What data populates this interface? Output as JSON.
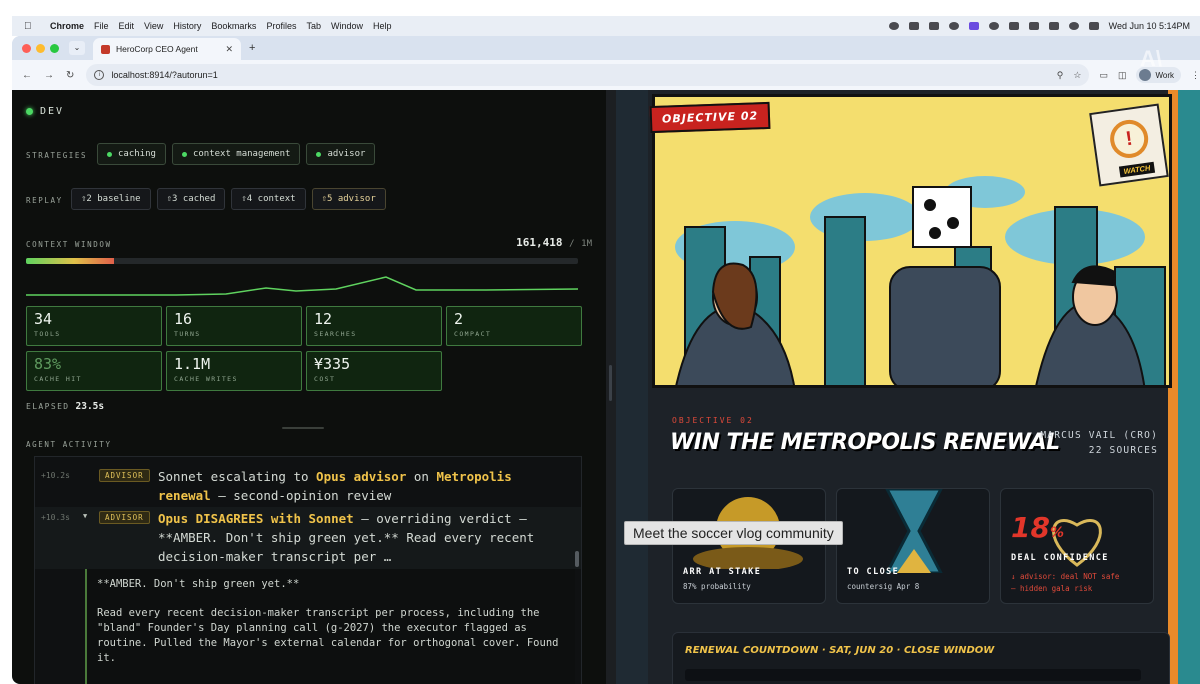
{
  "menubar": {
    "app": "Chrome",
    "items": [
      "File",
      "Edit",
      "View",
      "History",
      "Bookmarks",
      "Profiles",
      "Tab",
      "Window",
      "Help"
    ],
    "clock": "Wed Jun 10  5:14PM"
  },
  "browser": {
    "tab_title": "HeroCorp CEO Agent",
    "url": "localhost:8914/?autorun=1",
    "profile": "Work"
  },
  "dev": {
    "env_label": "DEV",
    "strategies_label": "STRATEGIES",
    "strategies": [
      "caching",
      "context management",
      "advisor"
    ],
    "replay_label": "REPLAY",
    "replays": [
      "⇧2 baseline",
      "⇧3 cached",
      "⇧4 context",
      "⇧5 advisor"
    ],
    "context_label": "CONTEXT WINDOW",
    "context_value": "161,418",
    "context_sep": "/",
    "context_max": "1M",
    "context_fill": 0.16,
    "stats": [
      {
        "value": "34",
        "key": "TOOLS"
      },
      {
        "value": "16",
        "key": "TURNS"
      },
      {
        "value": "12",
        "key": "SEARCHES"
      },
      {
        "value": "2",
        "key": "COMPACT"
      },
      {
        "value": "83%",
        "key": "CACHE HIT"
      },
      {
        "value": "1.1M",
        "key": "CACHE WRITES"
      },
      {
        "value": "¥335",
        "key": "COST"
      }
    ],
    "elapsed_label": "ELAPSED",
    "elapsed_value": "23.5s",
    "activity_label": "AGENT ACTIVITY"
  },
  "activity": {
    "row1": {
      "ts": "+10.2s",
      "badge": "ADVISOR",
      "t1": "Sonnet escalating to ",
      "h1": "Opus advisor",
      "t2": " on ",
      "h2": "Metropolis renewal",
      "t3": " — second-opinion review"
    },
    "row2": {
      "ts": "+10.3s",
      "tri": "▼",
      "badge": "ADVISOR",
      "h1": "Opus DISAGREES with Sonnet",
      "t1": " — overriding verdict — **AMBER. Don't ship green yet.** Read every recent decision-maker transcript per …"
    },
    "detail_p1": "**AMBER. Don't ship green yet.**",
    "detail_p2": "Read every recent decision-maker transcript per process, including the \"bland\" Founder's Day planning call (g-2027) the executor flagged as routine. Pulled the Mayor's external calendar for orthogonal cover. Found it."
  },
  "comic": {
    "objective_tag": "OBJECTIVE 02",
    "watch_label": "WATCH",
    "watch_glyph": "!",
    "sub_objective": "OBJECTIVE 02",
    "title": "WIN THE METROPOLIS RENEWAL",
    "owner": "MARCUS VAIL (CRO)",
    "sources": "22 SOURCES",
    "cards": [
      {
        "title": "ARR AT STAKE",
        "sub": "87% probability"
      },
      {
        "title": "TO CLOSE",
        "sub": "countersig Apr 8"
      },
      {
        "value": "18",
        "unit": "%",
        "title": "DEAL CONFIDENCE",
        "warn1": "↓ advisor: deal NOT safe",
        "warn2": "— hidden gala risk"
      }
    ],
    "countdown": "RENEWAL COUNTDOWN · SAT, JUN 20 · CLOSE WINDOW"
  },
  "tooltip": "Meet the soccer vlog community",
  "colors": {
    "accent_green": "#4cd964",
    "advisor_gold": "#f0c34a",
    "comic_red": "#c8231f"
  }
}
